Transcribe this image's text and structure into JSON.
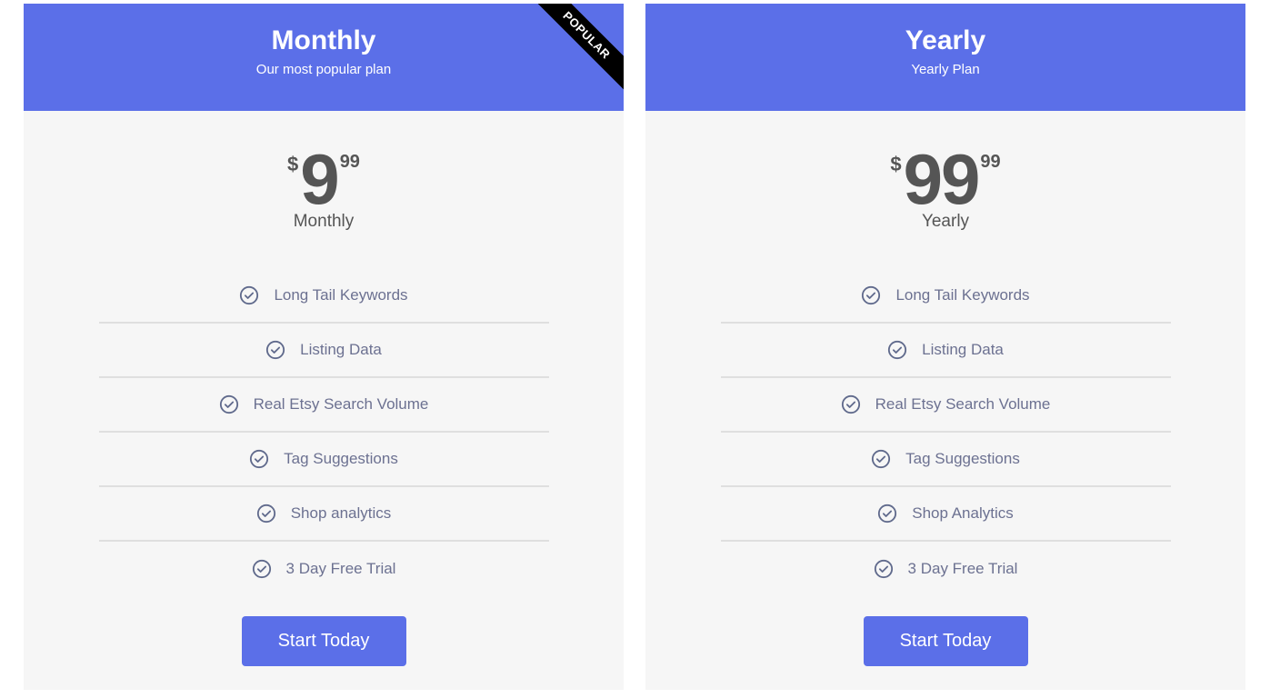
{
  "colors": {
    "accent": "#5b6fe8",
    "card_background": "#f6f6f6",
    "price_text": "#555555",
    "feature_text": "#6c7191",
    "ribbon": "#000000"
  },
  "plans": [
    {
      "title": "Monthly",
      "subtitle": "Our most popular plan",
      "ribbon": "POPULAR",
      "currency": "$",
      "amount": "9",
      "cents": "99",
      "period": "Monthly",
      "features": [
        {
          "icon": "check-circle-icon",
          "label": "Long Tail Keywords"
        },
        {
          "icon": "check-circle-icon",
          "label": "Listing Data"
        },
        {
          "icon": "check-circle-icon",
          "label": "Real Etsy Search Volume"
        },
        {
          "icon": "check-circle-icon",
          "label": "Tag Suggestions"
        },
        {
          "icon": "check-circle-icon",
          "label": "Shop analytics"
        },
        {
          "icon": "check-circle-icon",
          "label": "3 Day Free Trial"
        }
      ],
      "cta_label": "Start Today"
    },
    {
      "title": "Yearly",
      "subtitle": "Yearly Plan",
      "currency": "$",
      "amount": "99",
      "cents": "99",
      "period": "Yearly",
      "features": [
        {
          "icon": "check-circle-icon",
          "label": "Long Tail Keywords"
        },
        {
          "icon": "check-circle-icon",
          "label": "Listing Data"
        },
        {
          "icon": "check-circle-icon",
          "label": "Real Etsy Search Volume"
        },
        {
          "icon": "check-circle-icon",
          "label": "Tag Suggestions"
        },
        {
          "icon": "check-circle-icon",
          "label": "Shop Analytics"
        },
        {
          "icon": "check-circle-icon",
          "label": "3 Day Free Trial"
        }
      ],
      "cta_label": "Start Today"
    }
  ]
}
